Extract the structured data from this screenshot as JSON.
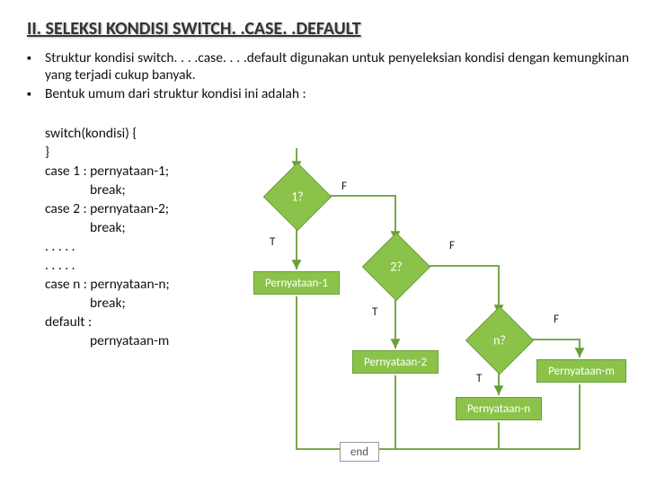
{
  "title": "II. SELEKSI KONDISI SWITCH. .CASE. .DEFAULT",
  "para1": "Struktur kondisi switch. . . .case. . . .default digunakan untuk penyeleksian kondisi dengan kemungkinan yang terjadi cukup banyak.",
  "para2": "Bentuk umum dari struktur kondisi ini adalah :",
  "code": {
    "l1": "switch(kondisi) {",
    "l2": "}",
    "l3": "case 1 : pernyataan-1;",
    "l4": "break;",
    "l5": "case 2 : pernyataan-2;",
    "l6": "break;",
    "l7": ". . . . .",
    "l8": ". . . . .",
    "l9": "case n : pernyataan-n;",
    "l10": "break;",
    "l11": "default :",
    "l12": "pernyataan-m"
  },
  "flow": {
    "d1": "1?",
    "d2": "2?",
    "dn": "n?",
    "p1": "Pernyataan-1",
    "p2": "Pernyataan-2",
    "pn": "Pernyataan-n",
    "pm": "Pernyataan-m",
    "end": "end",
    "T": "T",
    "F": "F"
  }
}
